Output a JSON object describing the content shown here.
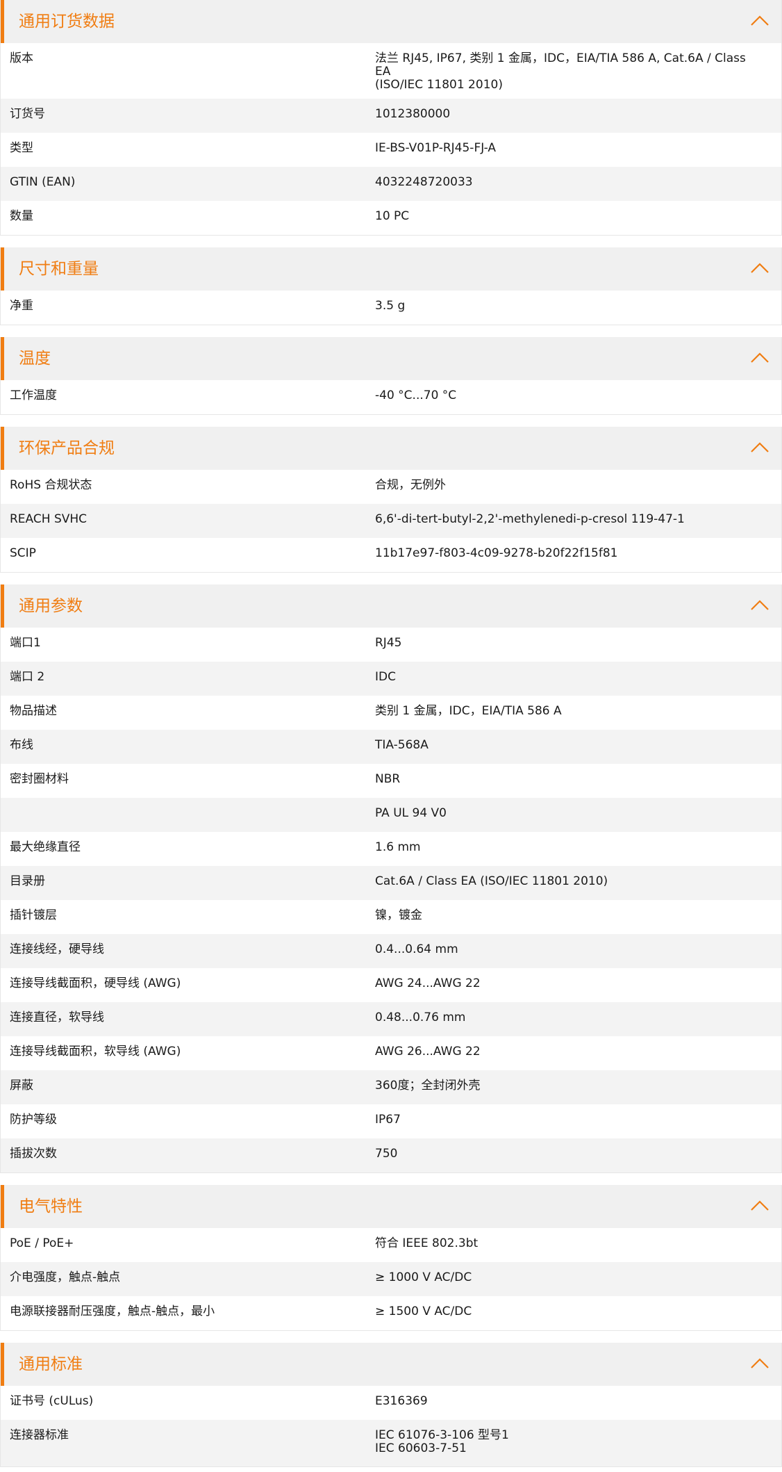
{
  "accent_color": "#f07d12",
  "sections": [
    {
      "title": "通用订货数据",
      "toggle_icon": "chevron-up-icon",
      "rows": [
        {
          "label": "版本",
          "value": [
            "法兰 RJ45, IP67, 类别 1 金属，IDC，EIA/TIA 586 A, Cat.6A / Class EA",
            "(ISO/IEC 11801 2010)"
          ]
        },
        {
          "label": "订货号",
          "value": [
            "1012380000"
          ]
        },
        {
          "label": "类型",
          "value": [
            "IE-BS-V01P-RJ45-FJ-A"
          ]
        },
        {
          "label": "GTIN (EAN)",
          "value": [
            "4032248720033"
          ]
        },
        {
          "label": "数量",
          "value": [
            "10  PC"
          ]
        }
      ]
    },
    {
      "title": "尺寸和重量",
      "toggle_icon": "chevron-up-icon",
      "rows": [
        {
          "label": "净重",
          "value": [
            "3.5  g"
          ]
        }
      ]
    },
    {
      "title": "温度",
      "toggle_icon": "chevron-up-icon",
      "rows": [
        {
          "label": "工作温度",
          "value": [
            "-40 °C...70 °C"
          ]
        }
      ]
    },
    {
      "title": "环保产品合规",
      "toggle_icon": "chevron-up-icon",
      "rows": [
        {
          "label": "RoHS 合规状态",
          "value": [
            "合规，无例外"
          ]
        },
        {
          "label": "REACH SVHC",
          "value": [
            "6,6'-di-tert-butyl-2,2'-methylenedi-p-cresol 119-47-1"
          ]
        },
        {
          "label": "SCIP",
          "value": [
            "11b17e97-f803-4c09-9278-b20f22f15f81"
          ]
        }
      ]
    },
    {
      "title": "通用参数",
      "toggle_icon": "chevron-up-icon",
      "rows": [
        {
          "label": "端口1",
          "value": [
            "RJ45"
          ]
        },
        {
          "label": "端口 2",
          "value": [
            "IDC"
          ]
        },
        {
          "label": "物品描述",
          "value": [
            "类别 1 金属，IDC，EIA/TIA 586 A"
          ]
        },
        {
          "label": "布线",
          "value": [
            "TIA-568A"
          ]
        },
        {
          "label": "密封圈材料",
          "value": [
            "NBR"
          ]
        },
        {
          "label": "",
          "value": [
            "PA UL 94 V0"
          ]
        },
        {
          "label": "最大绝缘直径",
          "value": [
            "1.6  mm"
          ]
        },
        {
          "label": "目录册",
          "value": [
            "Cat.6A / Class EA (ISO/IEC 11801 2010)"
          ]
        },
        {
          "label": "插针镀层",
          "value": [
            "镍，镀金"
          ]
        },
        {
          "label": "连接线经，硬导线",
          "value": [
            "0.4...0.64 mm"
          ]
        },
        {
          "label": "连接导线截面积，硬导线 (AWG)",
          "value": [
            "AWG 24...AWG 22"
          ]
        },
        {
          "label": "连接直径，软导线",
          "value": [
            "0.48...0.76 mm"
          ]
        },
        {
          "label": "连接导线截面积，软导线 (AWG)",
          "value": [
            "AWG 26...AWG 22"
          ]
        },
        {
          "label": "屏蔽",
          "value": [
            "360度；全封闭外壳"
          ]
        },
        {
          "label": "防护等级",
          "value": [
            "IP67"
          ]
        },
        {
          "label": "插拔次数",
          "value": [
            "750"
          ]
        }
      ]
    },
    {
      "title": "电气特性",
      "toggle_icon": "chevron-up-icon",
      "rows": [
        {
          "label": "PoE / PoE+",
          "value": [
            "符合 IEEE 802.3bt"
          ]
        },
        {
          "label": "介电强度，触点-触点",
          "value": [
            "≥ 1000 V AC/DC"
          ]
        },
        {
          "label": "电源联接器耐压强度，触点-触点，最小",
          "value": [
            "≥ 1500 V AC/DC"
          ]
        }
      ]
    },
    {
      "title": "通用标准",
      "toggle_icon": "chevron-up-icon",
      "rows": [
        {
          "label": "证书号 (cULus)",
          "value": [
            "E316369"
          ]
        },
        {
          "label": "连接器标准",
          "value": [
            "IEC 61076-3-106 型号1",
            "IEC 60603-7-51"
          ]
        }
      ]
    }
  ]
}
